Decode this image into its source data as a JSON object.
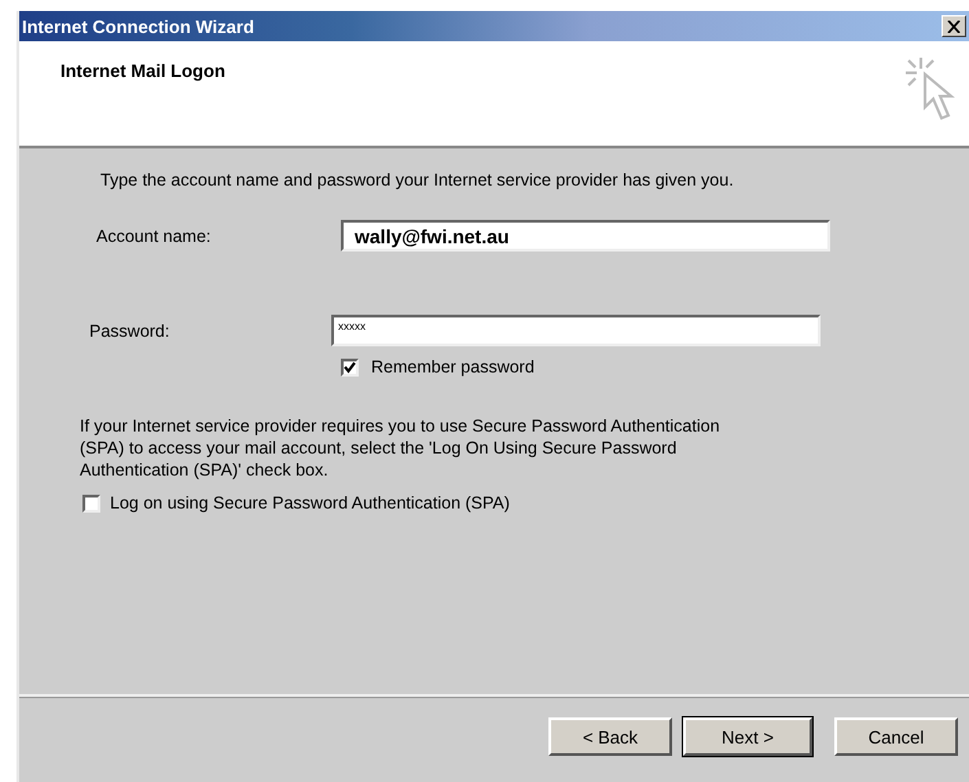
{
  "window": {
    "title": "Internet Connection Wizard"
  },
  "header": {
    "title": "Internet Mail Logon"
  },
  "instructions": "Type the account name and password your Internet service provider has given you.",
  "fields": [
    {
      "kind": "text",
      "label": "Account name:",
      "value": "wally@fwi.net.au"
    },
    {
      "kind": "password",
      "label": "Password:",
      "value": "xxxxx"
    }
  ],
  "remember": {
    "label": "Remember password",
    "checked": true
  },
  "spa_note": "If your Internet service provider requires you to use Secure Password Authentication (SPA) to access your mail account, select the 'Log On Using Secure Password Authentication (SPA)' check box.",
  "spa": {
    "label": "Log on using Secure Password Authentication (SPA)",
    "checked": false
  },
  "buttons": [
    {
      "label": "< Back",
      "default": false
    },
    {
      "label": "Next >",
      "default": true
    },
    {
      "label": "Cancel",
      "default": false
    }
  ]
}
